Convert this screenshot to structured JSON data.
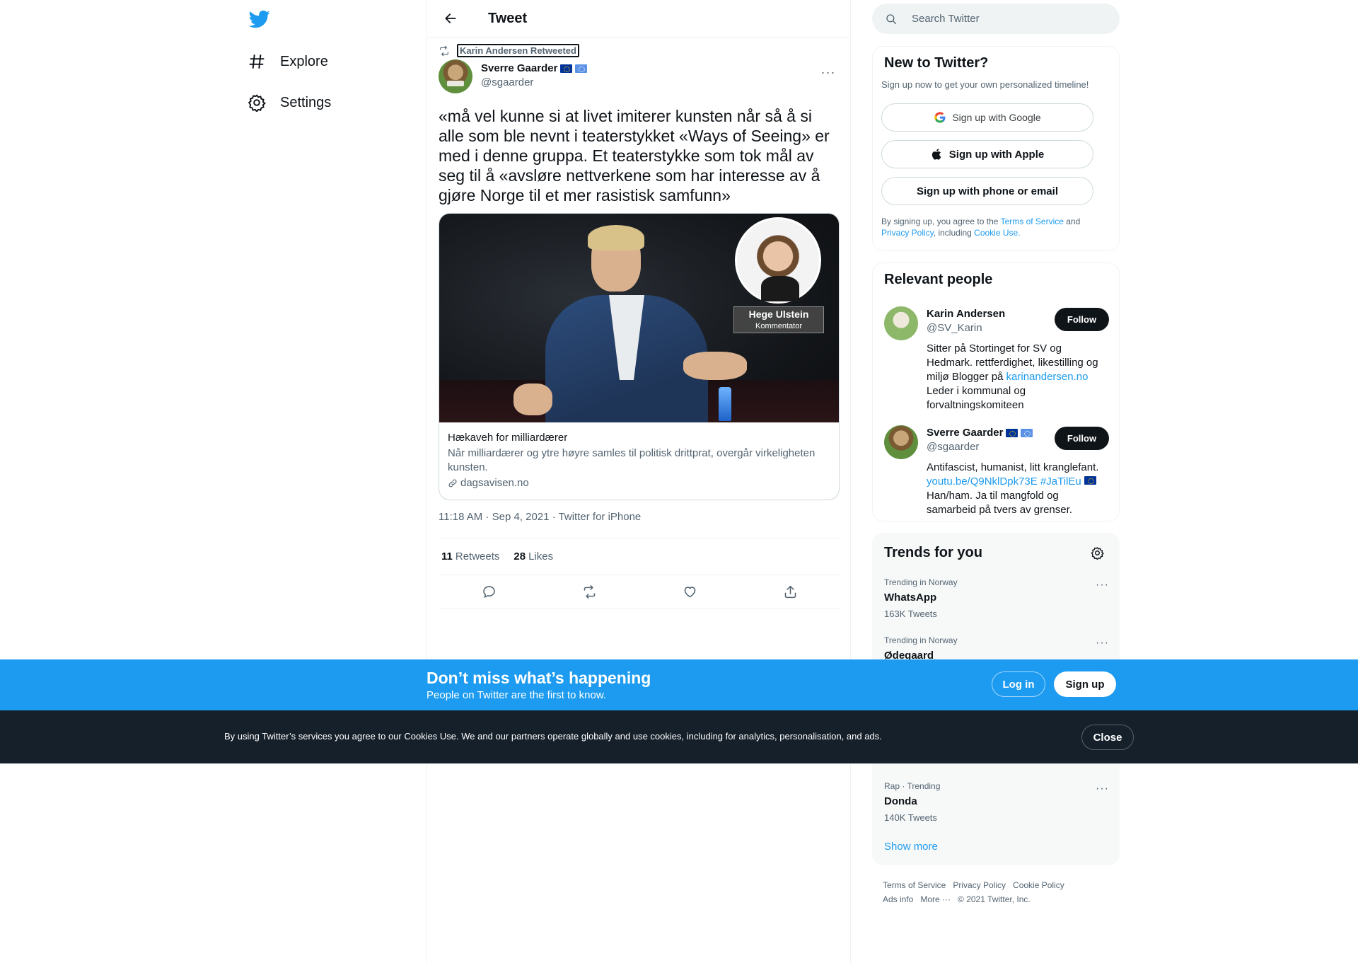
{
  "nav": {
    "explore_label": "Explore",
    "settings_label": "Settings"
  },
  "header": {
    "title": "Tweet"
  },
  "tweet": {
    "retweeted_by": "Karin Andersen Retweeted",
    "author_name": "Sverre Gaarder",
    "author_handle": "@sgaarder",
    "more_label": "···",
    "text": "«må vel kunne si at livet imiterer kunsten når så å si alle som ble nevnt i teaterstykket «Ways of Seeing» er med i denne gruppa. Et teaterstykke som tok mål av seg til å «avsløre nettverkene som har interesse av å gjøre Norge til et mer rasistisk samfunn»",
    "card": {
      "image_name_plate": "Hege Ulstein",
      "image_role_plate": "Kommentator",
      "title": "Hækaveh for milliardærer",
      "description": "Når milliardærer og ytre høyre samles til politisk drittprat, overgår virkeligheten kunsten.",
      "domain": "dagsavisen.no"
    },
    "timestamp": "11:18 AM · Sep 4, 2021 · Twitter for iPhone",
    "retweets_count": "11",
    "retweets_label": "Retweets",
    "likes_count": "28",
    "likes_label": "Likes"
  },
  "search": {
    "placeholder": "Search Twitter"
  },
  "new_to_twitter": {
    "title": "New to Twitter?",
    "subtitle": "Sign up now to get your own personalized timeline!",
    "google_label": "Sign up with Google",
    "apple_label": "Sign up with Apple",
    "phone_label": "Sign up with phone or email",
    "legal_prefix": "By signing up, you agree to the ",
    "terms_link": "Terms of Service",
    "legal_and": " and ",
    "privacy_link": "Privacy Policy",
    "legal_including": ", including ",
    "cookie_link": "Cookie Use."
  },
  "relevant_people": {
    "title": "Relevant people",
    "follow_label": "Follow",
    "people": [
      {
        "name": "Karin Andersen",
        "handle": "@SV_Karin",
        "bio_part1": "Sitter på Stortinget for SV og Hedmark. rettferdighet, likestilling og miljø Blogger på ",
        "bio_link": "karinandersen.no",
        "bio_part2": " Leder i kommunal og forvaltningskomiteen"
      },
      {
        "name": "Sverre Gaarder",
        "handle": "@sgaarder",
        "bio_part1": "Antifascist, humanist, litt kranglefant. ",
        "bio_link": "youtu.be/Q9NklDpk73E",
        "bio_hashtag": " #JaTilEu",
        "bio_part2": " Han/ham. Ja til mangfold og samarbeid på tvers av grenser."
      }
    ]
  },
  "trends": {
    "title": "Trends for you",
    "items": [
      {
        "context": "Trending in Norway",
        "name": "WhatsApp",
        "count": "163K Tweets"
      },
      {
        "context": "Trending in Norway",
        "name": "Ødegaard",
        "count": ""
      },
      {
        "context": "Rap · Trending",
        "name": "Donda",
        "count": "140K Tweets"
      }
    ],
    "show_more": "Show more"
  },
  "footer": {
    "terms": "Terms of Service",
    "privacy": "Privacy Policy",
    "cookie": "Cookie Policy",
    "ads": "Ads info",
    "more": "More ···",
    "copyright": "© 2021 Twitter, Inc."
  },
  "signup_bar": {
    "title": "Don’t miss what’s happening",
    "subtitle": "People on Twitter are the first to know.",
    "login_label": "Log in",
    "signup_label": "Sign up"
  },
  "cookie_bar": {
    "text": "By using Twitter’s services you agree to our Cookies Use. We and our partners operate globally and use cookies, including for analytics, personalisation, and ads.",
    "close_label": "Close"
  },
  "colors": {
    "accent": "#1d9bf0",
    "text_primary": "#0f1419",
    "text_secondary": "#536471",
    "cookie_bar_bg": "#15202b"
  }
}
